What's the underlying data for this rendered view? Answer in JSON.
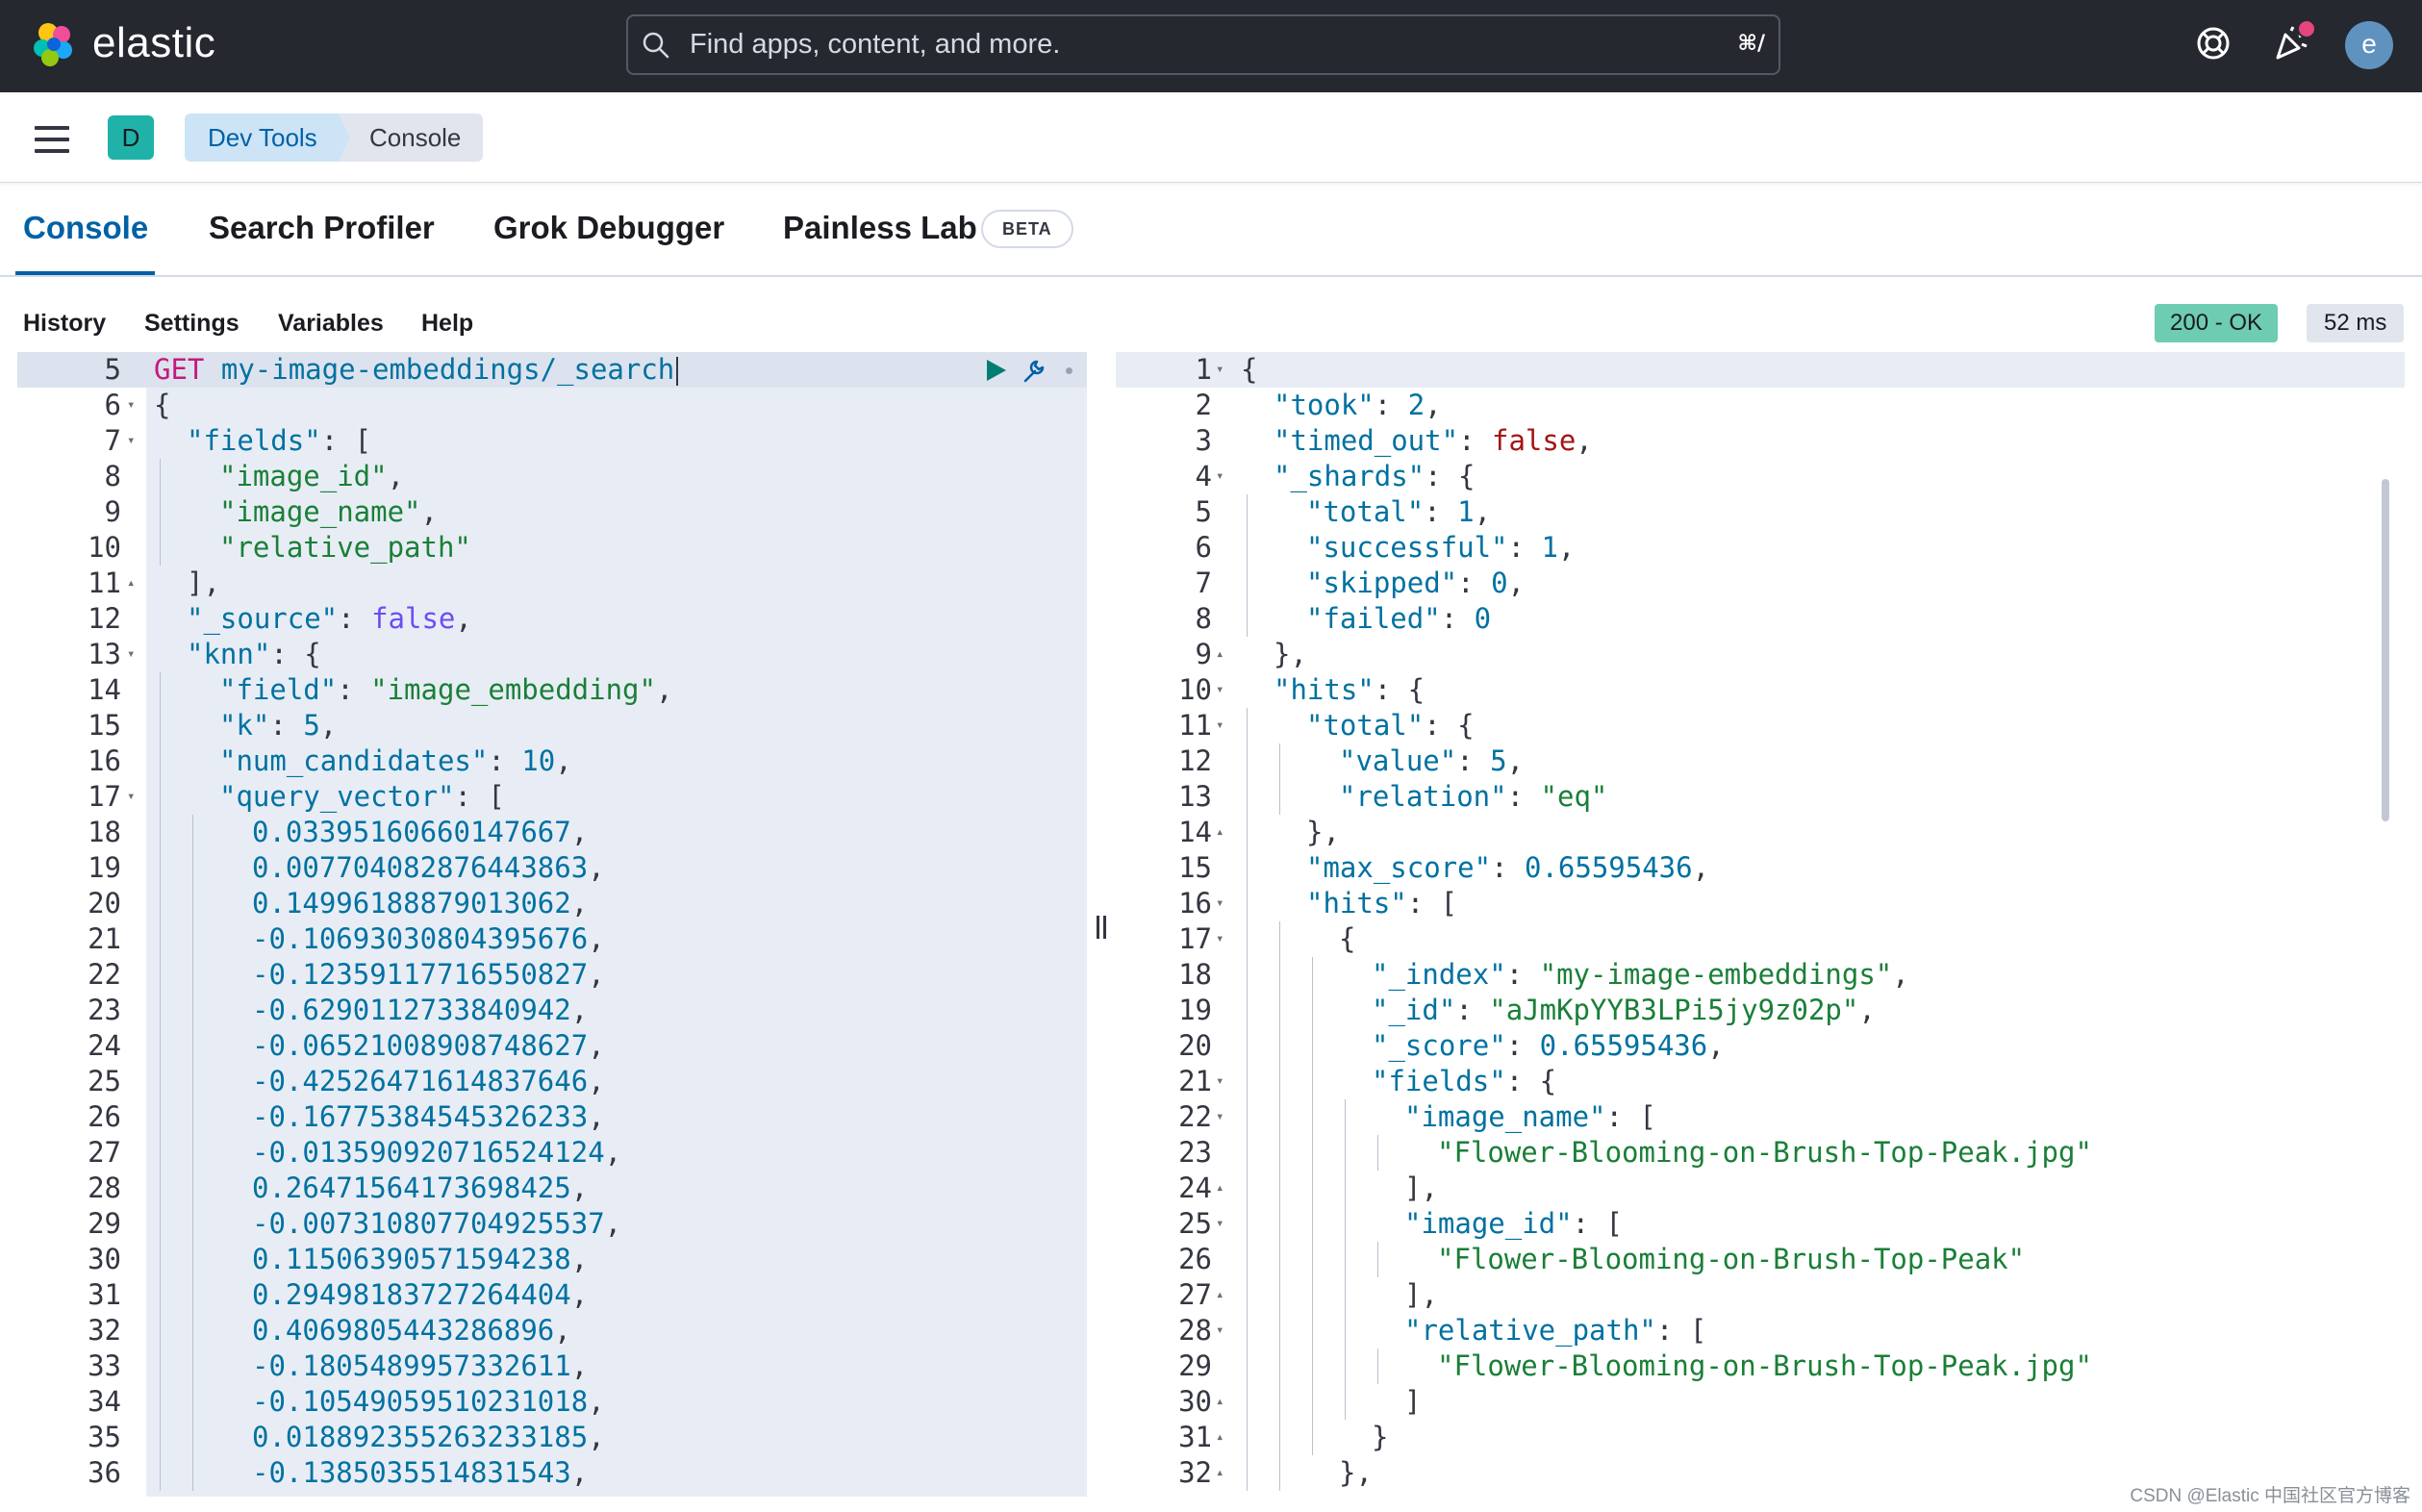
{
  "header": {
    "logo_text": "elastic",
    "search_placeholder": "Find apps, content, and more.",
    "search_shortcut": "⌘/",
    "avatar_initial": "e"
  },
  "navbar": {
    "space_initial": "D",
    "breadcrumbs": [
      "Dev Tools",
      "Console"
    ]
  },
  "tabs": {
    "items": [
      "Console",
      "Search Profiler",
      "Grok Debugger",
      "Painless Lab"
    ],
    "badge": "BETA",
    "active": "Console"
  },
  "console_menu": [
    "History",
    "Settings",
    "Variables",
    "Help"
  ],
  "status": {
    "code": "200 - OK",
    "time": "52 ms"
  },
  "request": {
    "lines": [
      {
        "n": "5",
        "fold": "",
        "indent": 0,
        "html": "<span class=\"m\">GET</span> <span class=\"k\">my-image-embeddings/_search</span>"
      },
      {
        "n": "6",
        "fold": "▾",
        "indent": 0,
        "html": "{"
      },
      {
        "n": "7",
        "fold": "▾",
        "indent": 1,
        "html": "<span class=\"k\">\"fields\"</span>: ["
      },
      {
        "n": "8",
        "fold": "",
        "indent": 2,
        "html": "<span class=\"s\">\"image_id\"</span>,"
      },
      {
        "n": "9",
        "fold": "",
        "indent": 2,
        "html": "<span class=\"s\">\"image_name\"</span>,"
      },
      {
        "n": "10",
        "fold": "",
        "indent": 2,
        "html": "<span class=\"s\">\"relative_path\"</span>"
      },
      {
        "n": "11",
        "fold": "▴",
        "indent": 1,
        "html": "],"
      },
      {
        "n": "12",
        "fold": "",
        "indent": 1,
        "html": "<span class=\"k\">\"_source\"</span>: <span class=\"bl\">false</span>,"
      },
      {
        "n": "13",
        "fold": "▾",
        "indent": 1,
        "html": "<span class=\"k\">\"knn\"</span>: {"
      },
      {
        "n": "14",
        "fold": "",
        "indent": 2,
        "html": "<span class=\"k\">\"field\"</span>: <span class=\"s\">\"image_embedding\"</span>,"
      },
      {
        "n": "15",
        "fold": "",
        "indent": 2,
        "html": "<span class=\"k\">\"k\"</span>: <span class=\"n\">5</span>,"
      },
      {
        "n": "16",
        "fold": "",
        "indent": 2,
        "html": "<span class=\"k\">\"num_candidates\"</span>: <span class=\"n\">10</span>,"
      },
      {
        "n": "17",
        "fold": "▾",
        "indent": 2,
        "html": "<span class=\"k\">\"query_vector\"</span>: ["
      },
      {
        "n": "18",
        "fold": "",
        "indent": 3,
        "html": "<span class=\"n\">0.03395160660147667</span>,"
      },
      {
        "n": "19",
        "fold": "",
        "indent": 3,
        "html": "<span class=\"n\">0.007704082876443863</span>,"
      },
      {
        "n": "20",
        "fold": "",
        "indent": 3,
        "html": "<span class=\"n\">0.14996188879013062</span>,"
      },
      {
        "n": "21",
        "fold": "",
        "indent": 3,
        "html": "<span class=\"n\">-0.10693030804395676</span>,"
      },
      {
        "n": "22",
        "fold": "",
        "indent": 3,
        "html": "<span class=\"n\">-0.12359117716550827</span>,"
      },
      {
        "n": "23",
        "fold": "",
        "indent": 3,
        "html": "<span class=\"n\">-0.6290112733840942</span>,"
      },
      {
        "n": "24",
        "fold": "",
        "indent": 3,
        "html": "<span class=\"n\">-0.06521008908748627</span>,"
      },
      {
        "n": "25",
        "fold": "",
        "indent": 3,
        "html": "<span class=\"n\">-0.42526471614837646</span>,"
      },
      {
        "n": "26",
        "fold": "",
        "indent": 3,
        "html": "<span class=\"n\">-0.16775384545326233</span>,"
      },
      {
        "n": "27",
        "fold": "",
        "indent": 3,
        "html": "<span class=\"n\">-0.013590920716524124</span>,"
      },
      {
        "n": "28",
        "fold": "",
        "indent": 3,
        "html": "<span class=\"n\">0.26471564173698425</span>,"
      },
      {
        "n": "29",
        "fold": "",
        "indent": 3,
        "html": "<span class=\"n\">-0.007310807704925537</span>,"
      },
      {
        "n": "30",
        "fold": "",
        "indent": 3,
        "html": "<span class=\"n\">0.11506390571594238</span>,"
      },
      {
        "n": "31",
        "fold": "",
        "indent": 3,
        "html": "<span class=\"n\">0.29498183727264404</span>,"
      },
      {
        "n": "32",
        "fold": "",
        "indent": 3,
        "html": "<span class=\"n\">0.4069805443286896</span>,"
      },
      {
        "n": "33",
        "fold": "",
        "indent": 3,
        "html": "<span class=\"n\">-0.1805489957332611</span>,"
      },
      {
        "n": "34",
        "fold": "",
        "indent": 3,
        "html": "<span class=\"n\">-0.10549059510231018</span>,"
      },
      {
        "n": "35",
        "fold": "",
        "indent": 3,
        "html": "<span class=\"n\">0.018892355263233185</span>,"
      },
      {
        "n": "36",
        "fold": "",
        "indent": 3,
        "html": "<span class=\"n\">-0.1385035514831543</span>,"
      }
    ]
  },
  "response": {
    "lines": [
      {
        "n": "1",
        "fold": "▾",
        "indent": 0,
        "html": "{"
      },
      {
        "n": "2",
        "fold": "",
        "indent": 1,
        "html": "<span class=\"k\">\"took\"</span>: <span class=\"n\">2</span>,"
      },
      {
        "n": "3",
        "fold": "",
        "indent": 1,
        "html": "<span class=\"k\">\"timed_out\"</span>: <span class=\"b\">false</span>,"
      },
      {
        "n": "4",
        "fold": "▾",
        "indent": 1,
        "html": "<span class=\"k\">\"_shards\"</span>: {"
      },
      {
        "n": "5",
        "fold": "",
        "indent": 2,
        "html": "<span class=\"k\">\"total\"</span>: <span class=\"n\">1</span>,"
      },
      {
        "n": "6",
        "fold": "",
        "indent": 2,
        "html": "<span class=\"k\">\"successful\"</span>: <span class=\"n\">1</span>,"
      },
      {
        "n": "7",
        "fold": "",
        "indent": 2,
        "html": "<span class=\"k\">\"skipped\"</span>: <span class=\"n\">0</span>,"
      },
      {
        "n": "8",
        "fold": "",
        "indent": 2,
        "html": "<span class=\"k\">\"failed\"</span>: <span class=\"n\">0</span>"
      },
      {
        "n": "9",
        "fold": "▴",
        "indent": 1,
        "html": "},"
      },
      {
        "n": "10",
        "fold": "▾",
        "indent": 1,
        "html": "<span class=\"k\">\"hits\"</span>: {"
      },
      {
        "n": "11",
        "fold": "▾",
        "indent": 2,
        "html": "<span class=\"k\">\"total\"</span>: {"
      },
      {
        "n": "12",
        "fold": "",
        "indent": 3,
        "html": "<span class=\"k\">\"value\"</span>: <span class=\"n\">5</span>,"
      },
      {
        "n": "13",
        "fold": "",
        "indent": 3,
        "html": "<span class=\"k\">\"relation\"</span>: <span class=\"s\">\"eq\"</span>"
      },
      {
        "n": "14",
        "fold": "▴",
        "indent": 2,
        "html": "},"
      },
      {
        "n": "15",
        "fold": "",
        "indent": 2,
        "html": "<span class=\"k\">\"max_score\"</span>: <span class=\"n\">0.65595436</span>,"
      },
      {
        "n": "16",
        "fold": "▾",
        "indent": 2,
        "html": "<span class=\"k\">\"hits\"</span>: ["
      },
      {
        "n": "17",
        "fold": "▾",
        "indent": 3,
        "html": "{"
      },
      {
        "n": "18",
        "fold": "",
        "indent": 4,
        "html": "<span class=\"k\">\"_index\"</span>: <span class=\"s\">\"my-image-embeddings\"</span>,"
      },
      {
        "n": "19",
        "fold": "",
        "indent": 4,
        "html": "<span class=\"k\">\"_id\"</span>: <span class=\"s\">\"aJmKpYYB3LPi5jy9z02p\"</span>,"
      },
      {
        "n": "20",
        "fold": "",
        "indent": 4,
        "html": "<span class=\"k\">\"_score\"</span>: <span class=\"n\">0.65595436</span>,"
      },
      {
        "n": "21",
        "fold": "▾",
        "indent": 4,
        "html": "<span class=\"k\">\"fields\"</span>: {"
      },
      {
        "n": "22",
        "fold": "▾",
        "indent": 5,
        "html": "<span class=\"k\">\"image_name\"</span>: ["
      },
      {
        "n": "23",
        "fold": "",
        "indent": 6,
        "html": "<span class=\"s\">\"Flower-Blooming-on-Brush-Top-Peak.jpg\"</span>"
      },
      {
        "n": "24",
        "fold": "▴",
        "indent": 5,
        "html": "],"
      },
      {
        "n": "25",
        "fold": "▾",
        "indent": 5,
        "html": "<span class=\"k\">\"image_id\"</span>: ["
      },
      {
        "n": "26",
        "fold": "",
        "indent": 6,
        "html": "<span class=\"s\">\"Flower-Blooming-on-Brush-Top-Peak\"</span>"
      },
      {
        "n": "27",
        "fold": "▴",
        "indent": 5,
        "html": "],"
      },
      {
        "n": "28",
        "fold": "▾",
        "indent": 5,
        "html": "<span class=\"k\">\"relative_path\"</span>: ["
      },
      {
        "n": "29",
        "fold": "",
        "indent": 6,
        "html": "<span class=\"s\">\"Flower-Blooming-on-Brush-Top-Peak.jpg\"</span>"
      },
      {
        "n": "30",
        "fold": "▴",
        "indent": 5,
        "html": "]"
      },
      {
        "n": "31",
        "fold": "▴",
        "indent": 4,
        "html": "}"
      },
      {
        "n": "32",
        "fold": "▴",
        "indent": 3,
        "html": "},"
      }
    ]
  },
  "watermark": "CSDN @Elastic 中国社区官方博客",
  "colors": {
    "header_bg": "#25282f",
    "accent": "#0061a6",
    "status_ok": "#6dccb1"
  }
}
